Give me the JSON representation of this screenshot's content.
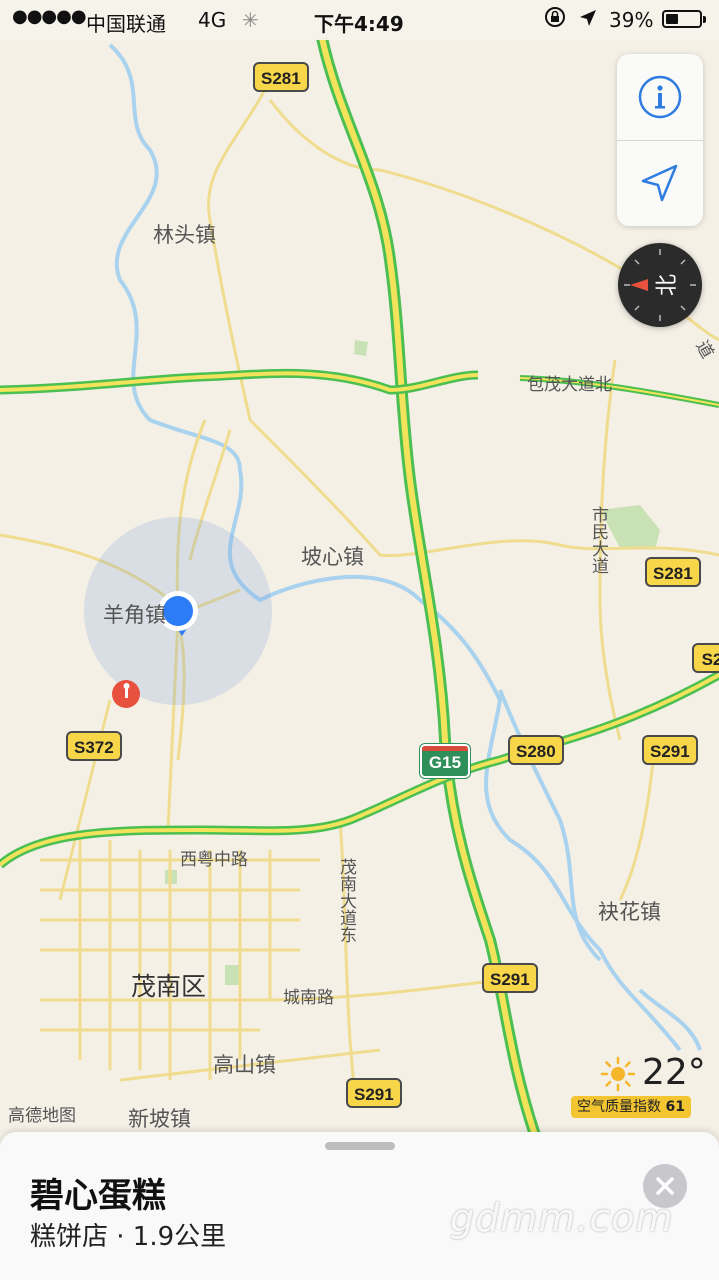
{
  "status_bar": {
    "signal": "●●●●●",
    "carrier": "中国联通",
    "network": "4G",
    "time": "下午4:49",
    "battery_percent": "39%",
    "battery_level": 0.39
  },
  "map": {
    "roads": {
      "s281_top": "S281",
      "s281_right": "S281",
      "s372": "S372",
      "s280": "S280",
      "s291_right": "S291",
      "s291_mid": "S291",
      "s291_bottom": "S291",
      "s2_edge": "S2",
      "g15": "G15"
    },
    "places": {
      "lintou": "林头镇",
      "baomao": "包茂大道北",
      "poxin": "坡心镇",
      "shimin": "市民大道",
      "yangjiao": "羊角镇",
      "xiyue": "西粤中路",
      "maonan_east": "茂南大道东",
      "maonan_district": "茂南区",
      "chengnan": "城南路",
      "gaoshan": "高山镇",
      "xinpo": "新坡镇",
      "gonghua": "袂花镇",
      "edge_char": "道"
    },
    "logo": "高德地图"
  },
  "controls": {
    "info_icon": "info-icon",
    "locate_icon": "location-arrow-icon",
    "compass_label": "北"
  },
  "weather": {
    "temperature": "22°",
    "aqi_label": "空气质量指数",
    "aqi_value": "61"
  },
  "card": {
    "title": "碧心蛋糕",
    "subtitle": "糕饼店 · 1.9公里"
  },
  "watermark": "gdmm.com",
  "colors": {
    "highway_green": "#4cbf52",
    "highway_yellow": "#f2e35a",
    "river_blue": "#9ccbec",
    "location_blue": "#2c7cf6",
    "pin_red": "#e8513d"
  }
}
